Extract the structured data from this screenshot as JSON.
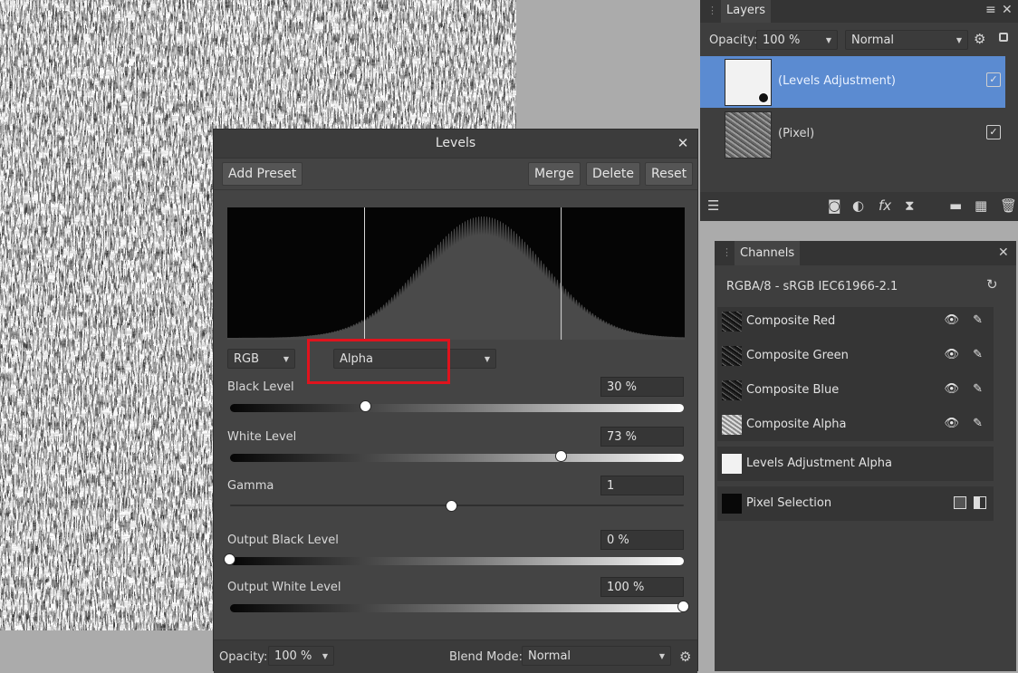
{
  "layers_panel": {
    "tab_label": "Layers",
    "opacity_label": "Opacity:",
    "opacity_value": "100 %",
    "blend_value": "Normal",
    "items": [
      {
        "name": "(Levels Adjustment)",
        "checked": true,
        "selected": true
      },
      {
        "name": "(Pixel)",
        "checked": true,
        "selected": false
      }
    ],
    "menu_icon": "hamburger-icon",
    "close_icon": "close-icon"
  },
  "levels_dialog": {
    "title": "Levels",
    "buttons": {
      "add_preset": "Add Preset",
      "merge": "Merge",
      "delete": "Delete",
      "reset": "Reset"
    },
    "color_space_select": "RGB",
    "channel_select": "Alpha",
    "controls": [
      {
        "label": "Black Level",
        "value": "30 %",
        "level": 0.3
      },
      {
        "label": "White Level",
        "value": "73 %",
        "level": 0.73
      },
      {
        "label": "Gamma",
        "value": "1",
        "level": 0.49
      },
      {
        "label": "Output Black Level",
        "value": "0 %",
        "level": 0.0
      },
      {
        "label": "Output White Level",
        "value": "100 %",
        "level": 1.0
      }
    ],
    "opacity_label": "Opacity:",
    "opacity_value": "100 %",
    "blend_mode_label": "Blend Mode:",
    "blend_mode_value": "Normal",
    "highlight_color": "#e0131d"
  },
  "channels_panel": {
    "tab_label": "Channels",
    "info": "RGBA/8 - sRGB IEC61966-2.1",
    "channels": [
      "Composite Red",
      "Composite Green",
      "Composite Blue",
      "Composite Alpha"
    ],
    "extra": [
      "Levels Adjustment Alpha",
      "Pixel Selection"
    ]
  },
  "colors": {
    "selection_blue": "#5b8bd1",
    "panel_bg": "#3e3e3e",
    "dialog_bg": "#444444"
  }
}
